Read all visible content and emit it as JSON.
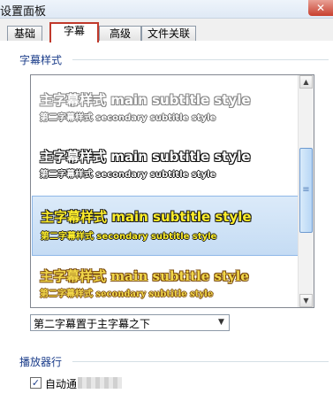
{
  "window": {
    "title": "设置面板",
    "close_glyph": "✕"
  },
  "tabs": [
    {
      "label": "基础"
    },
    {
      "label": "字幕",
      "active": true
    },
    {
      "label": "高级"
    },
    {
      "label": "文件关联"
    }
  ],
  "subtitle_style": {
    "group_title": "字幕样式",
    "styles": [
      {
        "main": "主字幕样式 main subtitle style",
        "secondary": "第二字幕样式 secondary subtitle style"
      },
      {
        "main": "主字幕样式 main subtitle style",
        "secondary": "第二字幕样式 secondary subtitle style"
      },
      {
        "main": "主字幕样式 main subtitle style",
        "secondary": "第二字幕样式 secondary subtitle style",
        "selected": true
      },
      {
        "main": "主字幕样式 main subtitle style",
        "secondary": "第二字幕样式 secondary subtitle style"
      }
    ],
    "scroll_up": "▲",
    "scroll_down": "▼",
    "scroll_grip": "≡",
    "position_select": {
      "value": "第二字幕置于主字幕之下",
      "arrow": "▼"
    }
  },
  "player": {
    "group_title": "播放器行",
    "checkbox": {
      "checked": true,
      "mark": "✓",
      "label": "自动通"
    }
  },
  "colors": {
    "accent_tab_border": "#c0392b",
    "selection": "#c5dcf4",
    "group_title": "#1b3d8a"
  }
}
